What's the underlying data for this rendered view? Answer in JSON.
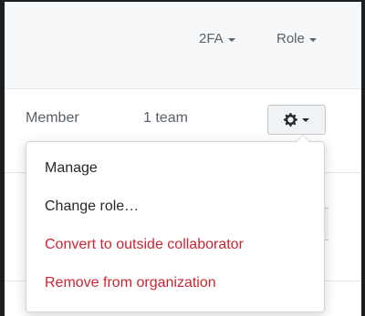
{
  "filters": {
    "twofa_label": "2FA",
    "role_label": "Role"
  },
  "member": {
    "role": "Member",
    "teams": "1 team"
  },
  "actions_menu": {
    "trigger_icon": "gear-icon",
    "items": [
      {
        "label": "Manage",
        "variant": "default"
      },
      {
        "label": "Change role…",
        "variant": "default"
      },
      {
        "label": "Convert to outside collaborator",
        "variant": "danger"
      },
      {
        "label": "Remove from organization",
        "variant": "danger"
      }
    ]
  },
  "colors": {
    "danger": "#cb2431",
    "muted_text": "#586069",
    "header_background": "#f6f8fa"
  }
}
